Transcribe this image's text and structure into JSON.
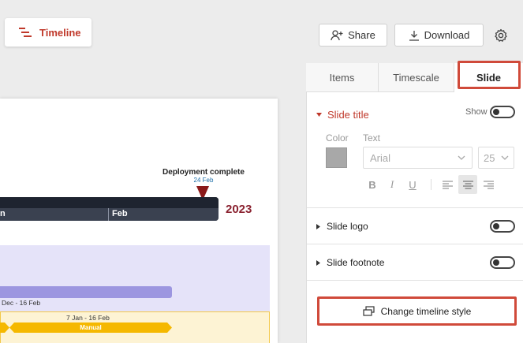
{
  "header": {
    "timeline_label": "Timeline",
    "share_label": "Share",
    "download_label": "Download",
    "timeline_icon": "timeline-icon",
    "share_icon": "add-user-icon",
    "download_icon": "download-icon",
    "settings_icon": "gear-icon"
  },
  "slide": {
    "milestone_title": "Deployment complete",
    "milestone_date": "24 Feb",
    "scale_labels": [
      "n",
      "Feb"
    ],
    "year": "2023",
    "task_dates": "Dec - 16 Feb",
    "manual_dates": "7 Jan - 16 Feb",
    "manual_label": "Manual",
    "colors": {
      "scale_dark": "#1e2430",
      "year": "#8b2331",
      "swimlane1": "#e5e3f9",
      "task_bar": "#9c96e0",
      "swimlane2": "#fdf3d4",
      "manual_bar": "#f5b800",
      "milestone": "#8b1a1a"
    }
  },
  "panel": {
    "tabs": [
      {
        "label": "Items"
      },
      {
        "label": "Timescale"
      },
      {
        "label": "Slide"
      }
    ],
    "slide_title": {
      "label": "Slide title",
      "show_label": "Show",
      "color_label": "Color",
      "text_label": "Text",
      "font_value": "Arial",
      "size_value": "25",
      "bold": "B",
      "italic": "I",
      "underline": "U"
    },
    "slide_logo": {
      "label": "Slide logo"
    },
    "slide_footnote": {
      "label": "Slide footnote"
    },
    "change_style_label": "Change timeline style",
    "accent_color": "#c0392b",
    "highlight_color": "#d04a3a"
  }
}
